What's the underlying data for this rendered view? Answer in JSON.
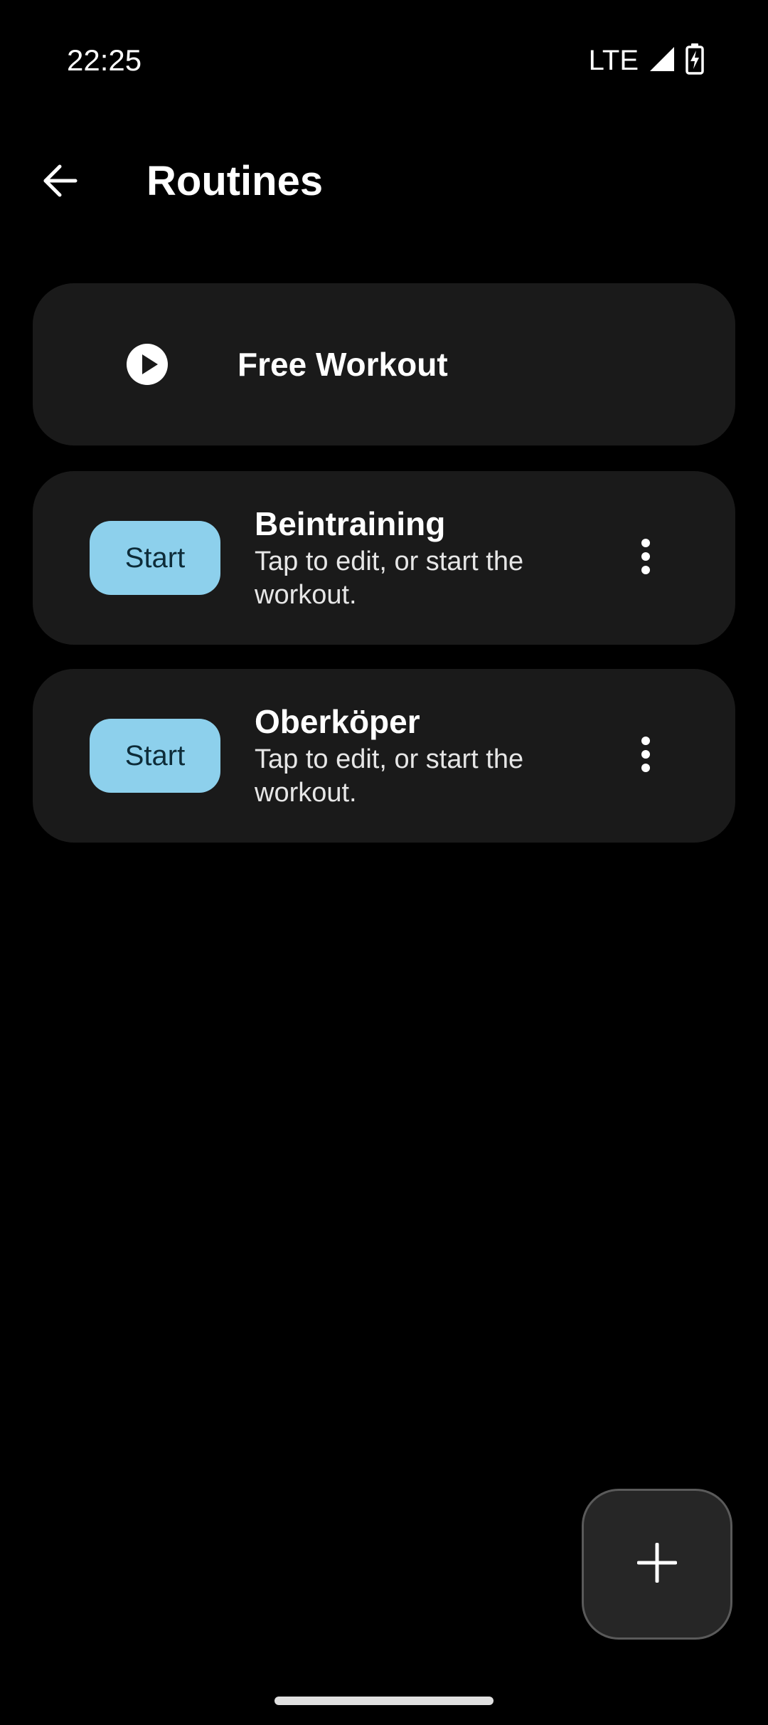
{
  "status_bar": {
    "time": "22:25",
    "network": "LTE",
    "icons": [
      "signal-icon",
      "battery-charging-icon"
    ]
  },
  "app_bar": {
    "title": "Routines",
    "back_icon": "arrow-left-icon"
  },
  "free_workout": {
    "label": "Free Workout",
    "icon": "play-circle-icon"
  },
  "routines": [
    {
      "title": "Beintraining",
      "subtitle": "Tap to edit, or start the workout.",
      "start_label": "Start",
      "menu_icon": "more-vert-icon"
    },
    {
      "title": "Oberköper",
      "subtitle": "Tap to edit, or start the workout.",
      "start_label": "Start",
      "menu_icon": "more-vert-icon"
    }
  ],
  "fab": {
    "icon": "plus-icon"
  },
  "colors": {
    "background": "#000000",
    "card": "#1a1a1a",
    "start_button": "#8dd0ec",
    "fab": "#262626"
  }
}
